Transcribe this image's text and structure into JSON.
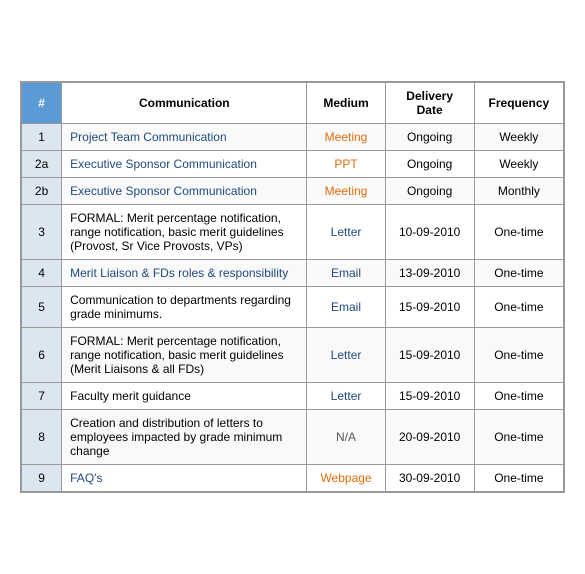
{
  "table": {
    "headers": {
      "hash": "#",
      "communication": "Communication",
      "medium": "Medium",
      "delivery_date": "Delivery Date",
      "frequency": "Frequency"
    },
    "rows": [
      {
        "num": "1",
        "comm": "Project Team Communication",
        "comm_color": "blue",
        "medium": "Meeting",
        "medium_color": "orange",
        "date": "Ongoing",
        "frequency": "Weekly"
      },
      {
        "num": "2a",
        "comm": "Executive Sponsor Communication",
        "comm_color": "blue",
        "medium": "PPT",
        "medium_color": "orange",
        "date": "Ongoing",
        "frequency": "Weekly"
      },
      {
        "num": "2b",
        "comm": "Executive Sponsor Communication",
        "comm_color": "blue",
        "medium": "Meeting",
        "medium_color": "orange",
        "date": "Ongoing",
        "frequency": "Monthly"
      },
      {
        "num": "3",
        "comm": "FORMAL: Merit percentage notification, range notification, basic merit guidelines (Provost, Sr Vice Provosts, VPs)",
        "comm_color": "black",
        "medium": "Letter",
        "medium_color": "blue",
        "date": "10-09-2010",
        "frequency": "One-time"
      },
      {
        "num": "4",
        "comm": "Merit Liaison & FDs roles & responsibility",
        "comm_color": "blue",
        "medium": "Email",
        "medium_color": "blue",
        "date": "13-09-2010",
        "frequency": "One-time"
      },
      {
        "num": "5",
        "comm": "Communication to departments regarding grade minimums.",
        "comm_color": "black",
        "medium": "Email",
        "medium_color": "blue",
        "date": "15-09-2010",
        "frequency": "One-time"
      },
      {
        "num": "6",
        "comm": "FORMAL: Merit percentage notification, range notification, basic merit guidelines (Merit Liaisons & all FDs)",
        "comm_color": "black",
        "medium": "Letter",
        "medium_color": "blue",
        "date": "15-09-2010",
        "frequency": "One-time"
      },
      {
        "num": "7",
        "comm": "Faculty merit guidance",
        "comm_color": "black",
        "medium": "Letter",
        "medium_color": "blue",
        "date": "15-09-2010",
        "frequency": "One-time"
      },
      {
        "num": "8",
        "comm": "Creation and distribution of letters to employees impacted by grade minimum change",
        "comm_color": "black",
        "medium": "N/A",
        "medium_color": "gray",
        "date": "20-09-2010",
        "frequency": "One-time"
      },
      {
        "num": "9",
        "comm": "FAQ's",
        "comm_color": "blue",
        "medium": "Webpage",
        "medium_color": "orange",
        "date": "30-09-2010",
        "frequency": "One-time"
      }
    ]
  }
}
